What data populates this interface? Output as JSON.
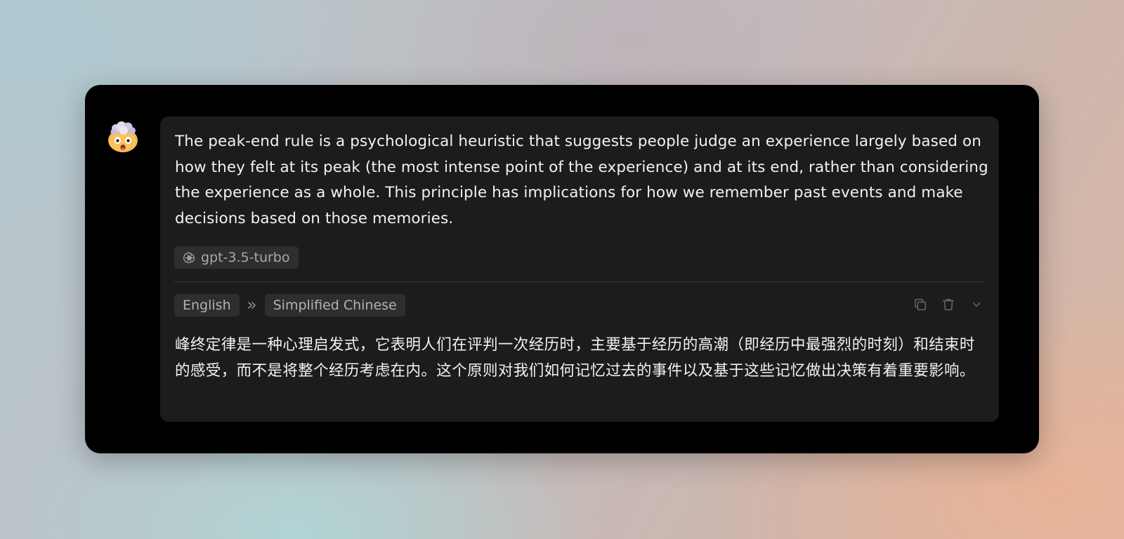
{
  "message": {
    "avatar_icon": "exploding-head-emoji-icon",
    "source_text": "The peak-end rule is a psychological heuristic that suggests people judge an experience largely based on how they felt at its peak (the most intense point of the experience) and at its end, rather than considering the experience as a whole. This principle has implications for how we remember past events and make decisions based on those memories.",
    "model": {
      "icon": "openai-logo-icon",
      "label": "gpt-3.5-turbo"
    }
  },
  "translation": {
    "source_language": "English",
    "arrow_icon": "double-chevron-right-icon",
    "target_language": "Simplified Chinese",
    "actions": [
      {
        "name": "copy-button",
        "icon": "copy-icon"
      },
      {
        "name": "delete-button",
        "icon": "trash-icon"
      },
      {
        "name": "expand-button",
        "icon": "chevron-down-icon"
      }
    ],
    "text": "峰终定律是一种心理启发式，它表明人们在评判一次经历时，主要基于经历的高潮（即经历中最强烈的时刻）和结束时的感受，而不是将整个经历考虑在内。这个原则对我们如何记忆过去的事件以及基于这些记忆做出决策有着重要影响。"
  },
  "colors": {
    "window_bg": "#000000",
    "card_bg": "#1c1c1c",
    "chip_bg": "#2e2e2e",
    "text_primary": "#f2f2f2",
    "text_muted": "#a8a8a8"
  }
}
